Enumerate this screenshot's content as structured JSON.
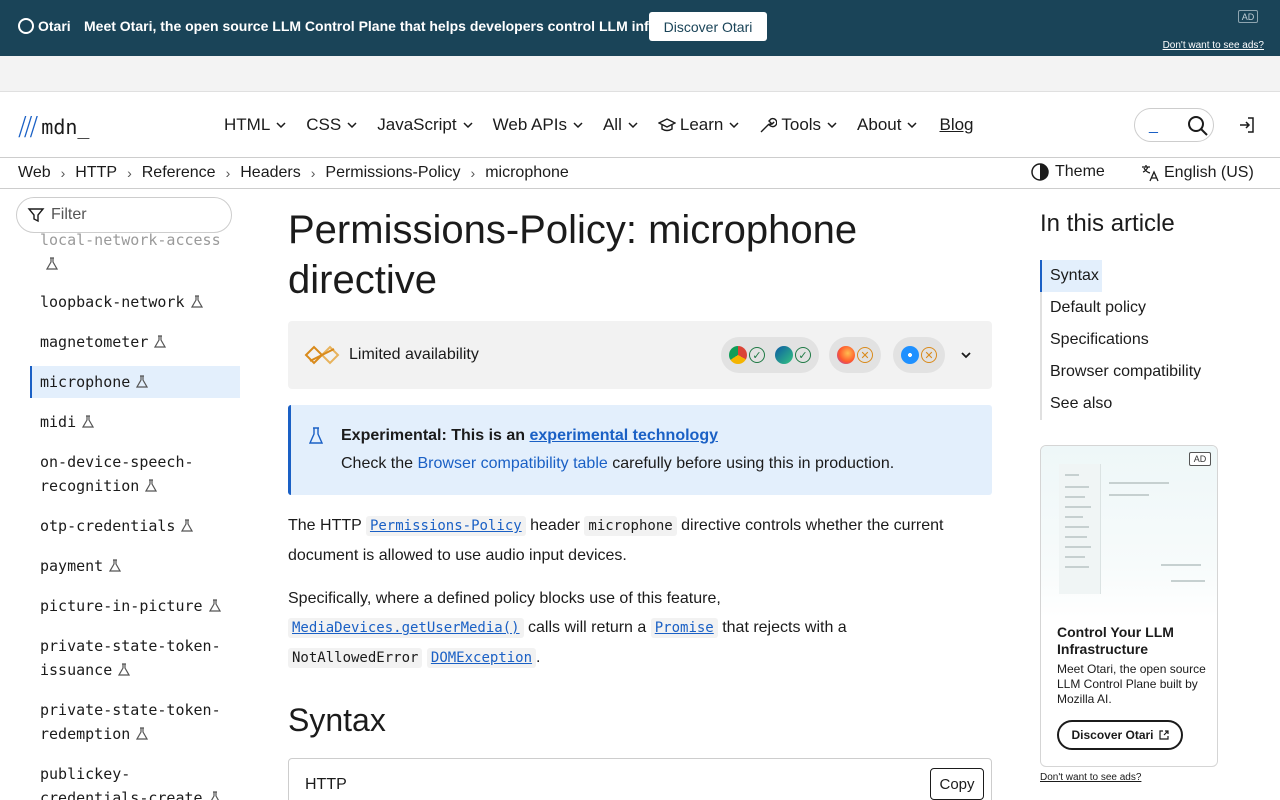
{
  "ad_banner": {
    "brand": "Otari",
    "message": "Meet Otari, the open source LLM Control Plane that helps developers control LLM infrastructure.",
    "cta": "Discover Otari",
    "ad_tag": "AD",
    "no_ads": "Don't want to see ads?"
  },
  "header": {
    "logo_text": "mdn_",
    "nav": [
      {
        "label": "HTML"
      },
      {
        "label": "CSS"
      },
      {
        "label": "JavaScript"
      },
      {
        "label": "Web APIs"
      },
      {
        "label": "All"
      },
      {
        "label": "Learn"
      },
      {
        "label": "Tools"
      },
      {
        "label": "About"
      }
    ],
    "blog": "Blog",
    "search_value": "_"
  },
  "breadcrumbs": [
    "Web",
    "HTTP",
    "Reference",
    "Headers",
    "Permissions-Policy",
    "microphone"
  ],
  "theme_label": "Theme",
  "language_label": "English (US)",
  "sidebar": {
    "filter_placeholder": "Filter",
    "items": [
      {
        "label": "local-network-access"
      },
      {
        "label": "loopback-network"
      },
      {
        "label": "magnetometer"
      },
      {
        "label": "microphone"
      },
      {
        "label": "midi"
      },
      {
        "label": "on-device-speech-",
        "label2": "recognition"
      },
      {
        "label": "otp-credentials"
      },
      {
        "label": "payment"
      },
      {
        "label": "picture-in-picture"
      },
      {
        "label": "private-state-token-",
        "label2": "issuance"
      },
      {
        "label": "private-state-token-",
        "label2": "redemption"
      },
      {
        "label": "publickey-",
        "label2": "credentials-create"
      }
    ]
  },
  "main": {
    "title_line1": "Permissions-Policy: microphone",
    "title_line2": "directive",
    "availability": "Limited availability",
    "experimental_bold": "Experimental: This is an ",
    "experimental_link": "experimental technology",
    "check_pre": "Check the ",
    "check_link": "Browser compatibility table",
    "check_post": " carefully before using this in production.",
    "p1_a": "The HTTP ",
    "p1_code_link": "Permissions-Policy",
    "p1_b": " header ",
    "p1_code": "microphone",
    "p1_c": " directive controls whether the current document is allowed to use audio input devices.",
    "p2_a": "Specifically, where a defined policy blocks use of this feature,",
    "p2_code1": "MediaDevices.getUserMedia()",
    "p2_b": " calls will return a ",
    "p2_code2": "Promise",
    "p2_c": " that rejects with a",
    "p2_code3": "NotAllowedError",
    "p2_code4": "DOMException",
    "p2_d": ".",
    "syntax_heading": "Syntax",
    "code_lang": "HTTP",
    "copy_label": "Copy"
  },
  "toc": {
    "heading": "In this article",
    "items": [
      "Syntax",
      "Default policy",
      "Specifications",
      "Browser compatibility",
      "See also"
    ]
  },
  "side_ad": {
    "ad_tag": "AD",
    "title": "Control Your LLM Infrastructure",
    "desc": "Meet Otari, the open source LLM Control Plane built by Mozilla AI.",
    "cta": "Discover Otari",
    "no_ads": "Don't want to see ads?"
  },
  "colors": {
    "accent": "#1a60c5",
    "banner": "#1a4458",
    "note_bg": "#e3effc"
  }
}
